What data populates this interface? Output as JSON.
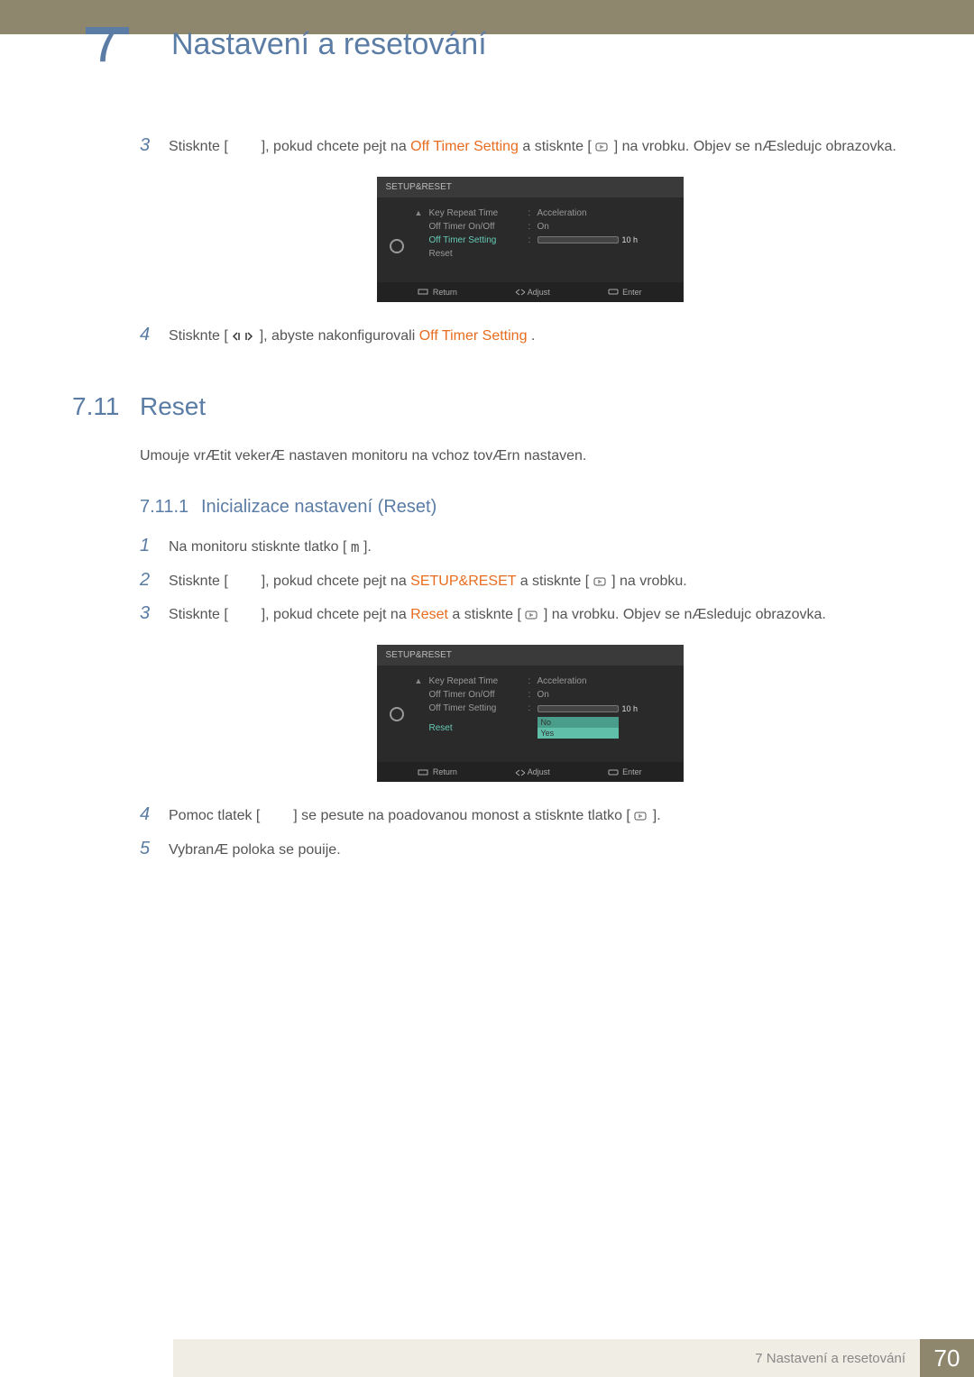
{
  "header": {
    "chapter_number": "7",
    "page_title": "Nastavení a resetování"
  },
  "steps_top": {
    "s3": {
      "num": "3",
      "t1": "Stisknte [",
      "t2": "], pokud chcete pejt na ",
      "hl1": "Off Timer Setting",
      "t3": " a stisknte [",
      "t4": "] na vrobku. Objev se nÆsledujc obrazovka."
    },
    "s4": {
      "num": "4",
      "t1": "Stisknte [",
      "t2": "], abyste nakonfigurovali ",
      "hl1": "Off Timer Setting",
      "t3": "."
    }
  },
  "osd1": {
    "title": "SETUP&RESET",
    "rows": {
      "keyrepeat": {
        "label": "Key Repeat Time",
        "value": "Acceleration"
      },
      "offtimer": {
        "label": "Off Timer On/Off",
        "value": "On"
      },
      "offset": {
        "label": "Off Timer Setting",
        "slider_text": "10 h"
      },
      "reset": {
        "label": "Reset"
      }
    },
    "footer": {
      "return": "Return",
      "adjust": "Adjust",
      "enter": "Enter"
    }
  },
  "section": {
    "num": "7.11",
    "title": "Reset",
    "desc": "Umouje vrÆtit vekerÆ nastaven monitoru na vchoz tovÆrn nastaven."
  },
  "subsection": {
    "num": "7.11.1",
    "title": "Inicializace nastavení (Reset)"
  },
  "steps_bottom": {
    "s1": {
      "num": "1",
      "t1": "Na monitoru stisknte tlatko [",
      "t2": "]."
    },
    "s2": {
      "num": "2",
      "t1": "Stisknte [",
      "t2": "], pokud chcete pejt na ",
      "hl1": "SETUP&RESET",
      "t3": " a stisknte [",
      "t4": "] na vrobku."
    },
    "s3": {
      "num": "3",
      "t1": "Stisknte [",
      "t2": "], pokud chcete pejt na ",
      "hl1": "Reset",
      "t3": " a stisknte [",
      "t4": "] na vrobku. Objev se nÆsledujc obrazovka."
    },
    "s4": {
      "num": "4",
      "t1": "Pomoc tlatek [",
      "t2": "] se pesute na poadovanou monost a stisknte tlatko [",
      "t3": "]."
    },
    "s5": {
      "num": "5",
      "t1": "VybranÆ poloka se pouije."
    }
  },
  "osd2": {
    "title": "SETUP&RESET",
    "rows": {
      "keyrepeat": {
        "label": "Key Repeat Time",
        "value": "Acceleration"
      },
      "offtimer": {
        "label": "Off Timer On/Off",
        "value": "On"
      },
      "offset": {
        "label": "Off Timer Setting",
        "slider_text": "10 h"
      },
      "reset": {
        "label": "Reset",
        "opt_no": "No",
        "opt_yes": "Yes"
      }
    },
    "footer": {
      "return": "Return",
      "adjust": "Adjust",
      "enter": "Enter"
    }
  },
  "footer": {
    "chapter_label": "7 Nastavení a resetování",
    "page_num": "70"
  },
  "glyphs": {
    "m": "m"
  }
}
